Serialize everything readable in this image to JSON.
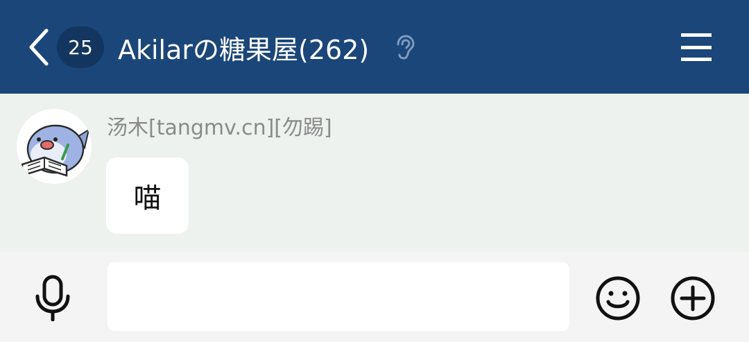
{
  "header": {
    "unread_count": "25",
    "title": "Akilarの糖果屋(262)"
  },
  "message": {
    "sender": "汤木[tangmv.cn][勿踢]",
    "text": "喵"
  },
  "input": {
    "value": "",
    "placeholder": ""
  },
  "colors": {
    "header_bg": "#1b4679",
    "badge_bg": "#133660",
    "chat_bg": "#edf2ef",
    "input_bar_bg": "#f4f4f4",
    "bubble_bg": "#ffffff",
    "sender_color": "#8a8a8a"
  },
  "icons": {
    "back": "chevron-left-icon",
    "listening": "ear-icon",
    "menu": "hamburger-menu-icon",
    "mic": "microphone-icon",
    "emoji": "smiley-icon",
    "more": "plus-circle-icon"
  }
}
